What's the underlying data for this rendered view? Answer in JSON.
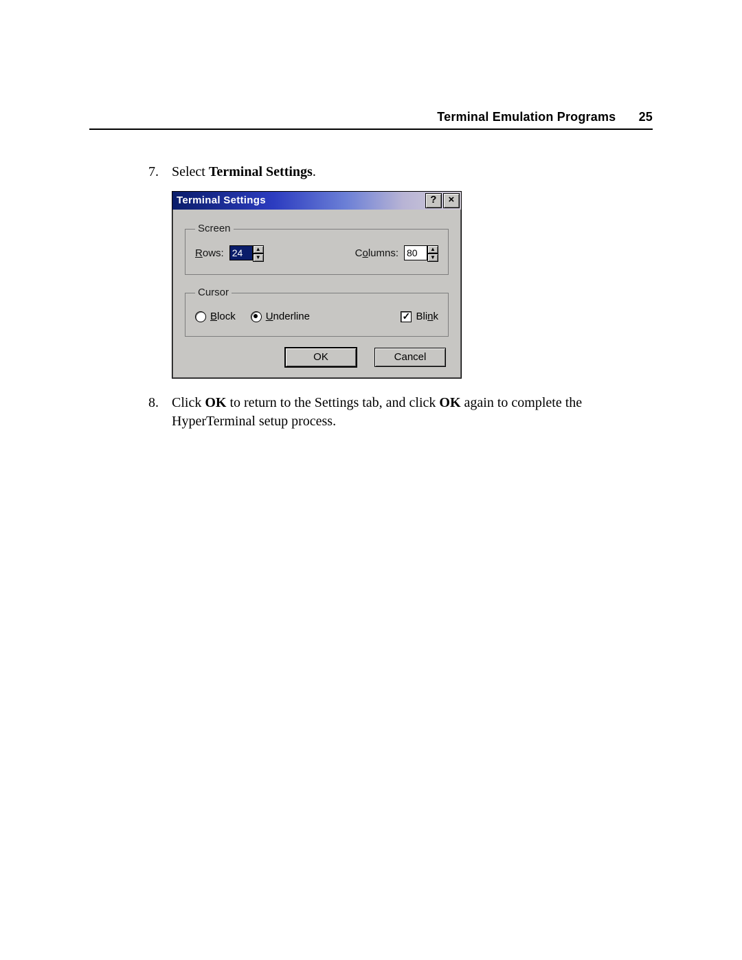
{
  "header": {
    "title": "Terminal Emulation Programs",
    "page_number": "25"
  },
  "steps": {
    "s7": {
      "num": "7.",
      "pre": "Select ",
      "bold": "Terminal Settings",
      "post": "."
    },
    "s8": {
      "num": "8.",
      "t1": "Click ",
      "b1": "OK",
      "t2": " to return to the Settings tab, and click ",
      "b2": "OK",
      "t3": " again to complete the HyperTerminal setup process."
    }
  },
  "dialog": {
    "title": "Terminal Settings",
    "help_glyph": "?",
    "close_glyph": "×",
    "screen": {
      "legend": "Screen",
      "rows_label_pre": "R",
      "rows_label_u": "o",
      "rows_label_post": "ws:",
      "rows_value": "24",
      "cols_label_pre": "C",
      "cols_label_u": "o",
      "cols_label_post": "lumns:",
      "cols_value": "80"
    },
    "cursor": {
      "legend": "Cursor",
      "block_u": "B",
      "block_rest": "lock",
      "under_u": "U",
      "under_rest": "nderline",
      "blink_pre": "Bli",
      "blink_u": "n",
      "blink_post": "k",
      "selected": "underline",
      "blink_checked": true
    },
    "buttons": {
      "ok": "OK",
      "cancel": "Cancel"
    }
  }
}
